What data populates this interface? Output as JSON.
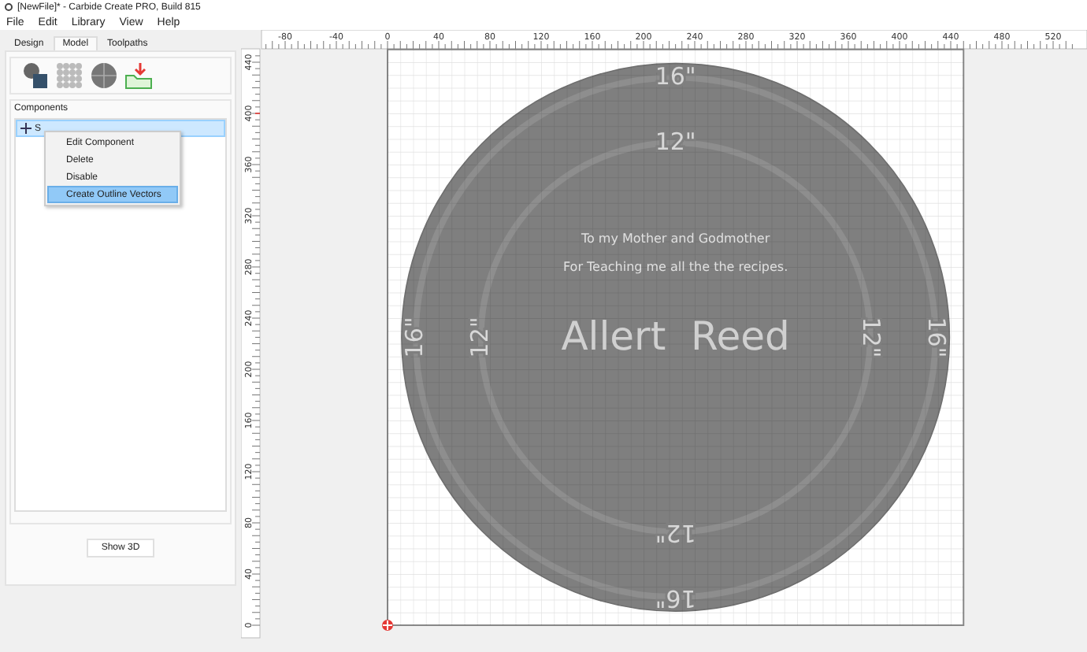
{
  "window": {
    "title": "[NewFile]* - Carbide Create PRO, Build 815"
  },
  "menu": [
    "File",
    "Edit",
    "Library",
    "View",
    "Help"
  ],
  "tabs": [
    {
      "label": "Design",
      "selected": false
    },
    {
      "label": "Model",
      "selected": true
    },
    {
      "label": "Toolpaths",
      "selected": false
    }
  ],
  "components": {
    "title": "Components",
    "items": [
      {
        "label": "S",
        "selected": true
      }
    ]
  },
  "context_menu": [
    {
      "label": "Edit Component",
      "selected": false
    },
    {
      "label": "Delete",
      "selected": false
    },
    {
      "label": "Disable",
      "selected": false
    },
    {
      "label": "Create Outline Vectors",
      "selected": true
    }
  ],
  "show_3d_button": "Show 3D",
  "rulers": {
    "horizontal": [
      "-80",
      "-40",
      "0",
      "40",
      "80",
      "120",
      "160",
      "200",
      "240",
      "280",
      "320",
      "360",
      "400",
      "440",
      "480",
      "520"
    ],
    "vertical": [
      "0",
      "40",
      "80",
      "120",
      "160",
      "200",
      "240",
      "280",
      "320",
      "360",
      "400",
      "440"
    ]
  },
  "design": {
    "dedication": [
      "To my Mother and Godmother",
      "For Teaching me all the the recipes."
    ],
    "name": "Allert  Reed",
    "ring_labels": [
      {
        "text": "16\"",
        "kind": "outer_top"
      },
      {
        "text": "12\"",
        "kind": "inner_top"
      },
      {
        "text": "16\"",
        "kind": "outer_left"
      },
      {
        "text": "12\"",
        "kind": "inner_left"
      },
      {
        "text": "12\"",
        "kind": "inner_right"
      },
      {
        "text": "16\"",
        "kind": "outer_right"
      },
      {
        "text": "12\"",
        "kind": "inner_bottom"
      },
      {
        "text": "16\"",
        "kind": "outer_bottom"
      }
    ]
  }
}
